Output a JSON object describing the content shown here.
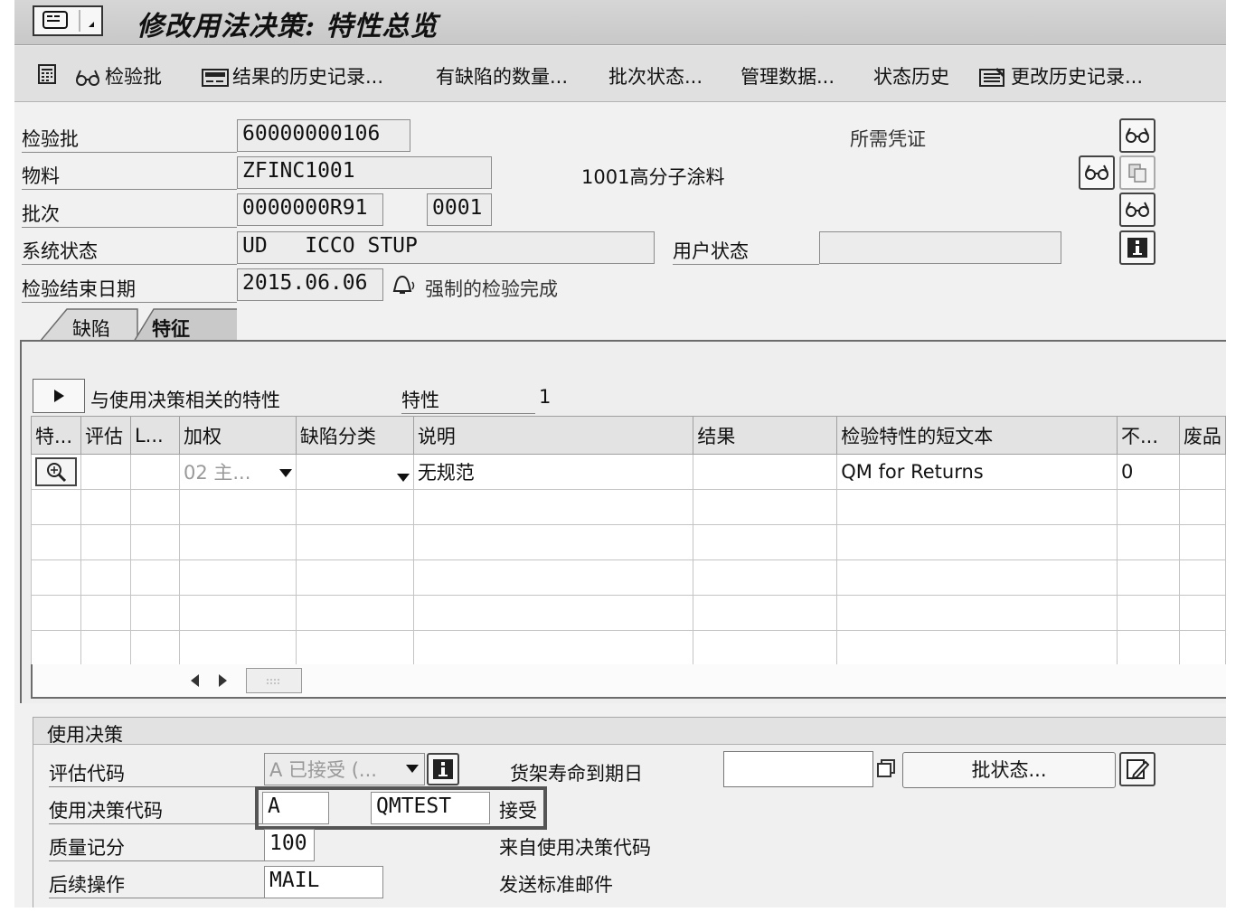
{
  "window": {
    "title": "修改用法决策: 特性总览"
  },
  "toolbar": {
    "items": [
      {
        "label": "检验批",
        "icon": "glasses-icon"
      },
      {
        "label": "结果的历史记录...",
        "icon": "history-icon"
      },
      {
        "label": "有缺陷的数量...",
        "icon": ""
      },
      {
        "label": "批次状态...",
        "icon": ""
      },
      {
        "label": "管理数据...",
        "icon": ""
      },
      {
        "label": "状态历史",
        "icon": ""
      },
      {
        "label": "更改历史记录...",
        "icon": "change-log-icon"
      }
    ]
  },
  "header": {
    "inspection_lot": {
      "label": "检验批",
      "value": "60000000106"
    },
    "material": {
      "label": "物料",
      "value": "ZFINC1001",
      "description": "1001高分子涂料"
    },
    "batch": {
      "label": "批次",
      "value": "0000000R91",
      "value2": "0001"
    },
    "system_status": {
      "label": "系统状态",
      "value": "UD   ICCO STUP"
    },
    "user_status": {
      "label": "用户状态",
      "value": ""
    },
    "end_date": {
      "label": "检验结束日期",
      "value": "2015.06.06",
      "note": "强制的检验完成"
    },
    "docs_required": {
      "label": "所需凭证"
    }
  },
  "tabs": [
    {
      "label": "缺陷",
      "active": false
    },
    {
      "label": "特征",
      "active": true
    }
  ],
  "characteristics": {
    "section_label": "与使用决策相关的特性",
    "count_label": "特性",
    "count_value": "1",
    "columns": [
      "特...",
      "评估",
      "L...",
      "加权",
      "缺陷分类",
      "说明",
      "结果",
      "检验特性的短文本",
      "不...",
      "废品"
    ],
    "rows": [
      {
        "weight": "02 主...",
        "defect_class": "",
        "description": "无规范",
        "result": "",
        "short_text": "QM for Returns",
        "nonconf": "0",
        "scrap": ""
      }
    ]
  },
  "usage_decision": {
    "title": "使用决策",
    "valuation_code": {
      "label": "评估代码",
      "value": "A 已接受 (..."
    },
    "shelf_life": {
      "label": "货架寿命到期日",
      "value": ""
    },
    "batch_status_button": "批状态...",
    "ud_code": {
      "label": "使用决策代码",
      "code": "A",
      "group": "QMTEST",
      "text": "接受"
    },
    "quality_score": {
      "label": "质量记分",
      "value": "100",
      "text": "来自使用决策代码"
    },
    "follow_up": {
      "label": "后续操作",
      "value": "MAIL",
      "text": "发送标准邮件"
    }
  }
}
